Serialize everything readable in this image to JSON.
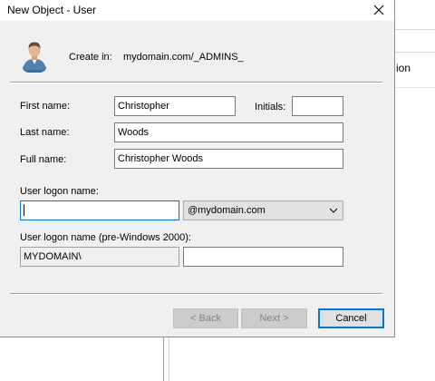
{
  "window": {
    "title": "New Object - User",
    "close_label": "Close"
  },
  "header": {
    "create_in_label": "Create in:",
    "create_in_value": "mydomain.com/_ADMINS_"
  },
  "form": {
    "first_name_label": "First name:",
    "first_name_value": "Christopher",
    "initials_label": "Initials:",
    "initials_value": "",
    "last_name_label": "Last name:",
    "last_name_value": "Woods",
    "full_name_label": "Full name:",
    "full_name_value": "Christopher Woods",
    "logon_name_label": "User logon name:",
    "logon_name_value": "",
    "domain_suffix_value": "@mydomain.com",
    "pre2000_label": "User logon name (pre-Windows 2000):",
    "pre2000_domain_value": "MYDOMAIN\\",
    "pre2000_name_value": ""
  },
  "buttons": {
    "back_label": "< Back",
    "next_label": "Next >",
    "cancel_label": "Cancel"
  },
  "background": {
    "fragment_text": "ion"
  },
  "colors": {
    "dialog_bg": "#f0f0f0",
    "focus_border": "#0078d7",
    "disabled_text": "#838383"
  }
}
